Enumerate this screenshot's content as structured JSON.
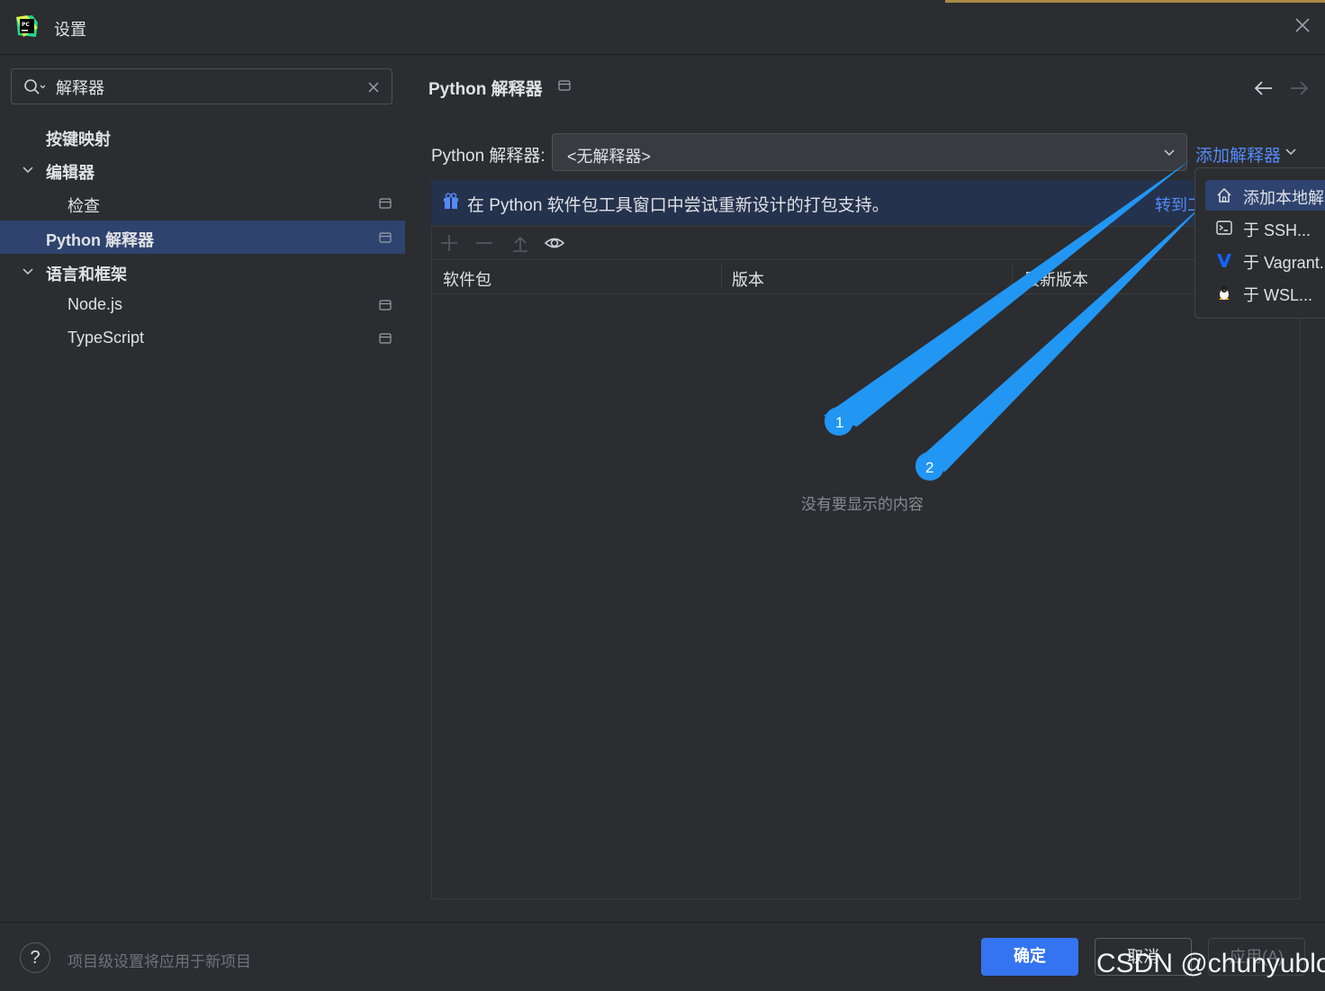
{
  "window": {
    "title": "设置"
  },
  "sidebar": {
    "search": {
      "value": "解释器"
    },
    "items": [
      {
        "label": "按键映射"
      },
      {
        "label": "编辑器"
      },
      {
        "label": "检查"
      },
      {
        "label": "Python 解释器"
      },
      {
        "label": "语言和框架"
      },
      {
        "label": "Node.js"
      },
      {
        "label": "TypeScript"
      }
    ]
  },
  "main": {
    "title": "Python 解释器",
    "interpreter_label": "Python 解释器:",
    "interpreter_value": "<无解释器>",
    "add_interpreter": "添加解释器",
    "banner": {
      "text": "在 Python 软件包工具窗口中尝试重新设计的打包支持。",
      "link": "转到工具窗口"
    },
    "table": {
      "columns": [
        "软件包",
        "版本",
        "最新版本"
      ],
      "empty_text": "没有要显示的内容"
    }
  },
  "popup": {
    "items": [
      {
        "label": "添加本地解释器...",
        "icon": "home-icon"
      },
      {
        "label": "于 SSH...",
        "icon": "terminal-icon"
      },
      {
        "label": "于 Vagrant...",
        "icon": "vagrant-icon"
      },
      {
        "label": "于 WSL...",
        "icon": "linux-icon"
      }
    ]
  },
  "annotations": {
    "marker1": "1",
    "marker2": "2"
  },
  "footer": {
    "help": "?",
    "note": "项目级设置将应用于新项目",
    "ok": "确定",
    "cancel": "取消",
    "apply": "应用(A)"
  },
  "watermark": "CSDN @chunyublog",
  "colors": {
    "accent": "#3574f0",
    "link": "#548af7",
    "selection": "#2e436e",
    "annotation": "#2196f3"
  }
}
